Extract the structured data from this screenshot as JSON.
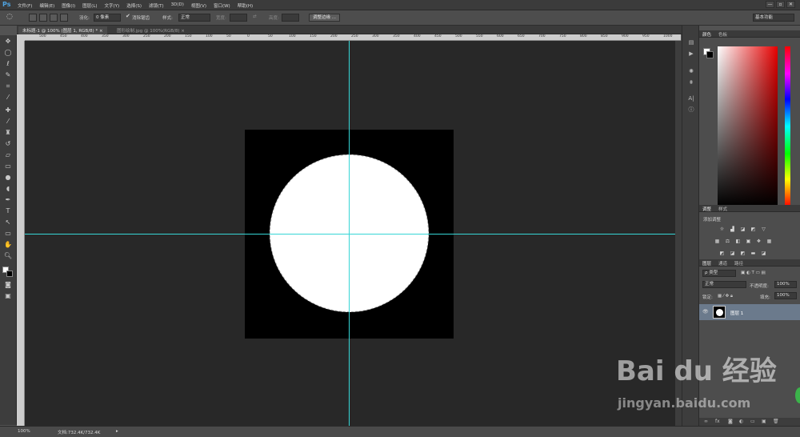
{
  "app": {
    "logo": "Ps"
  },
  "menu": [
    "文件(F)",
    "编辑(E)",
    "图像(I)",
    "图层(L)",
    "文字(Y)",
    "选择(S)",
    "滤镜(T)",
    "3D(D)",
    "视图(V)",
    "窗口(W)",
    "帮助(H)"
  ],
  "window_buttons": [
    "—",
    "▫",
    "✕"
  ],
  "options": {
    "feather_label": "羽化:",
    "feather_value": "0 像素",
    "antialias_label": "消除锯齿",
    "style_label": "样式:",
    "style_value": "正常",
    "width_label": "宽度:",
    "height_label": "高度:",
    "refine_button": "调整边缘 ...",
    "workspace": "基本功能"
  },
  "tabs": [
    {
      "label": "未标题-1 @ 100% (图层 1, RGB/8) *  ×",
      "active": true
    },
    {
      "label": "图形绘制.jpg @ 100%(RGB/8)  ×",
      "active": false
    }
  ],
  "ruler_marks": [
    "500",
    "450",
    "400",
    "350",
    "300",
    "250",
    "200",
    "150",
    "100",
    "50",
    "0",
    "50",
    "100",
    "150",
    "200",
    "250",
    "300",
    "350",
    "400",
    "450",
    "500",
    "550",
    "600",
    "650",
    "700",
    "750",
    "800",
    "850",
    "900",
    "950",
    "1000"
  ],
  "status": {
    "zoom": "100%",
    "doc": "文档:732.4K/732.4K"
  },
  "panels": {
    "color_tabs": [
      "颜色",
      "色板"
    ],
    "adjust_tabs": [
      "调整",
      "样式"
    ],
    "adjust_label": "添加调整",
    "layers_tabs": [
      "图层",
      "通道",
      "路径"
    ],
    "kind_filter": "ρ 类型",
    "blend_mode": "正常",
    "opacity_label": "不透明度:",
    "opacity_value": "100%",
    "lock_label": "锁定:",
    "fill_label": "填充:",
    "fill_value": "100%",
    "layer_name": "图层 1"
  },
  "watermark": {
    "brand": "Bai du 经验",
    "url": "jingyan.baidu.com"
  },
  "colors": {
    "guide": "#36d6d6",
    "canvas_bg": "#282828",
    "layer_selected": "#6b7a8c"
  }
}
